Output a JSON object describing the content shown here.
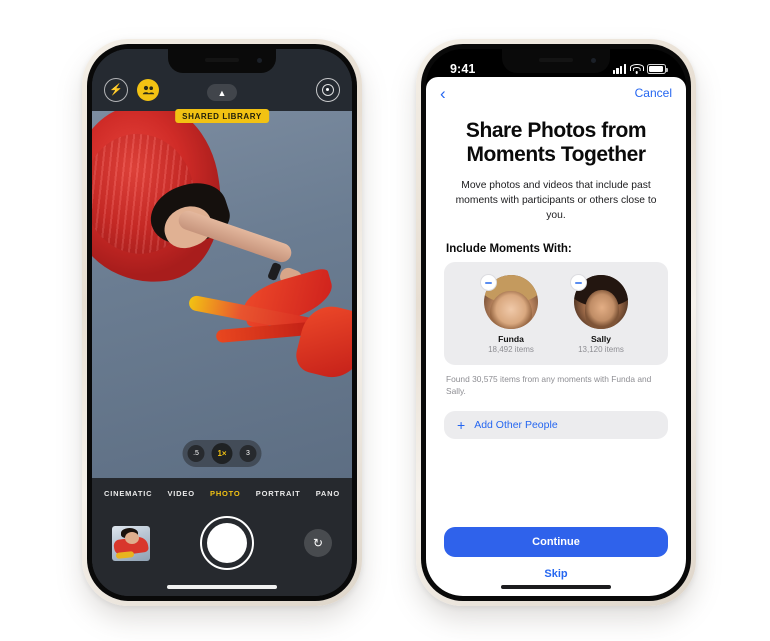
{
  "left_phone": {
    "app": "Camera",
    "topbar": {
      "flash_icon": "flash-bolt-icon",
      "shared_library_icon": "two-people-icon",
      "chevron_icon": "chevron-up-icon",
      "live_photo_icon": "live-photo-icon"
    },
    "shared_library_badge": "SHARED LIBRARY",
    "zoom_levels": [
      {
        "label": ".5",
        "active": false
      },
      {
        "label": "1×",
        "active": true
      },
      {
        "label": "3",
        "active": false
      }
    ],
    "modes": [
      {
        "label": "CINEMATIC",
        "active": false
      },
      {
        "label": "VIDEO",
        "active": false
      },
      {
        "label": "PHOTO",
        "active": true
      },
      {
        "label": "PORTRAIT",
        "active": false
      },
      {
        "label": "PANO",
        "active": false
      }
    ],
    "controls": {
      "thumbnail_name": "last-photo-thumbnail",
      "shutter_name": "shutter-button",
      "flip_icon": "camera-flip-icon",
      "flip_glyph": "↻"
    },
    "accent_yellow": "#f2c213"
  },
  "right_phone": {
    "status_bar": {
      "time": "9:41",
      "signal_icon": "cellular-signal-icon",
      "wifi_icon": "wifi-icon",
      "battery_icon": "battery-icon"
    },
    "nav": {
      "back_glyph": "‹",
      "back_icon": "back-chevron-icon",
      "cancel_label": "Cancel"
    },
    "title": "Share Photos from Moments Together",
    "subtitle": "Move photos and videos that include past moments with participants or others close to you.",
    "section_label": "Include Moments With:",
    "people": [
      {
        "name": "Funda",
        "items": "18,492 items",
        "remove_icon": "minus-circle-icon"
      },
      {
        "name": "Sally",
        "items": "13,120 items",
        "remove_icon": "minus-circle-icon"
      }
    ],
    "found_note": "Found 30,575 items from any moments with Funda and Sally.",
    "add_people": {
      "plus_glyph": "+",
      "label": "Add Other People"
    },
    "primary_button": "Continue",
    "secondary_button": "Skip",
    "accent_blue": "#2566f0",
    "button_blue": "#2f62eb"
  }
}
